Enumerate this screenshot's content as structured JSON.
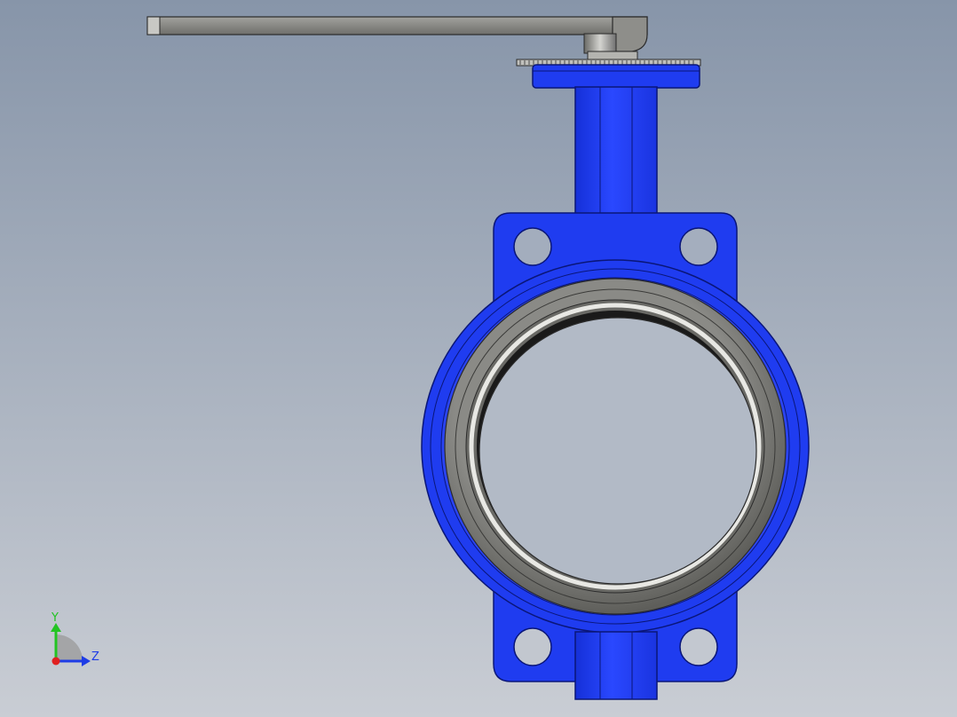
{
  "viewport": {
    "background_top": "#8795a9",
    "background_bottom": "#c9cdd4"
  },
  "model": {
    "part_name": "butterfly-valve",
    "body_color": "#1f3cf0",
    "body_edge_color": "#0a1678",
    "liner_color": "#7f7f7a",
    "handle_color": "#8c8c88",
    "hub_color": "#9a9a96"
  },
  "triad": {
    "y_label": "Y",
    "z_label": "Z",
    "y_color": "#22c422",
    "z_color": "#1e3ce6",
    "x_color": "#e02020"
  }
}
